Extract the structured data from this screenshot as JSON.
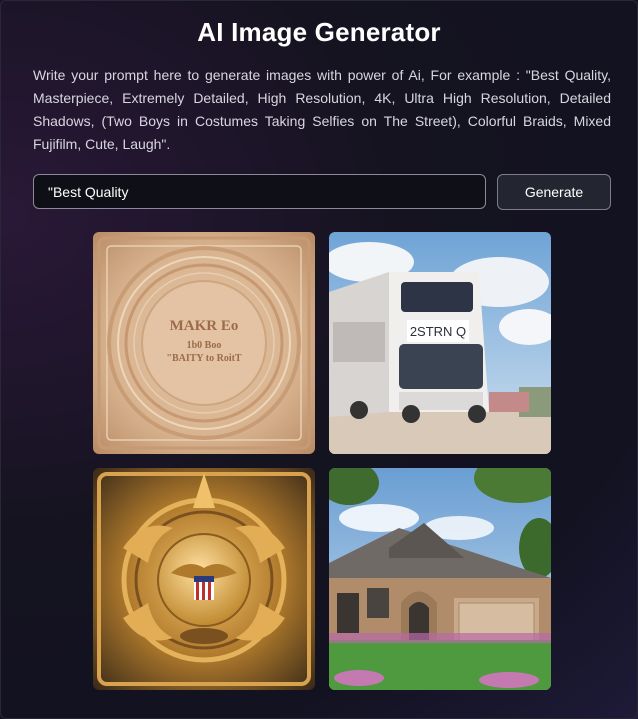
{
  "header": {
    "title": "AI Image Generator"
  },
  "description": "Write your prompt here to generate images with power of Ai, For example : \"Best Quality, Masterpiece, Extremely Detailed, High Resolution, 4K, Ultra High Resolution, Detailed Shadows, (Two Boys in Costumes Taking Selfies on The Street), Colorful Braids, Mixed Fujifilm, Cute, Laugh\".",
  "prompt": {
    "value": "\"Best Quality"
  },
  "generate_button": {
    "label": "Generate"
  },
  "images": [
    {
      "kind": "engraved-plaque",
      "text_lines": [
        "MAKR Eo",
        "1b0 Boo",
        "\"BAITY to RoitT"
      ]
    },
    {
      "kind": "white-bus",
      "sign_text": "2STRN Q"
    },
    {
      "kind": "golden-emblem"
    },
    {
      "kind": "brick-house"
    }
  ],
  "colors": {
    "background": "#151320",
    "input_border": "#8c8a98",
    "button_bg": "#232630"
  }
}
